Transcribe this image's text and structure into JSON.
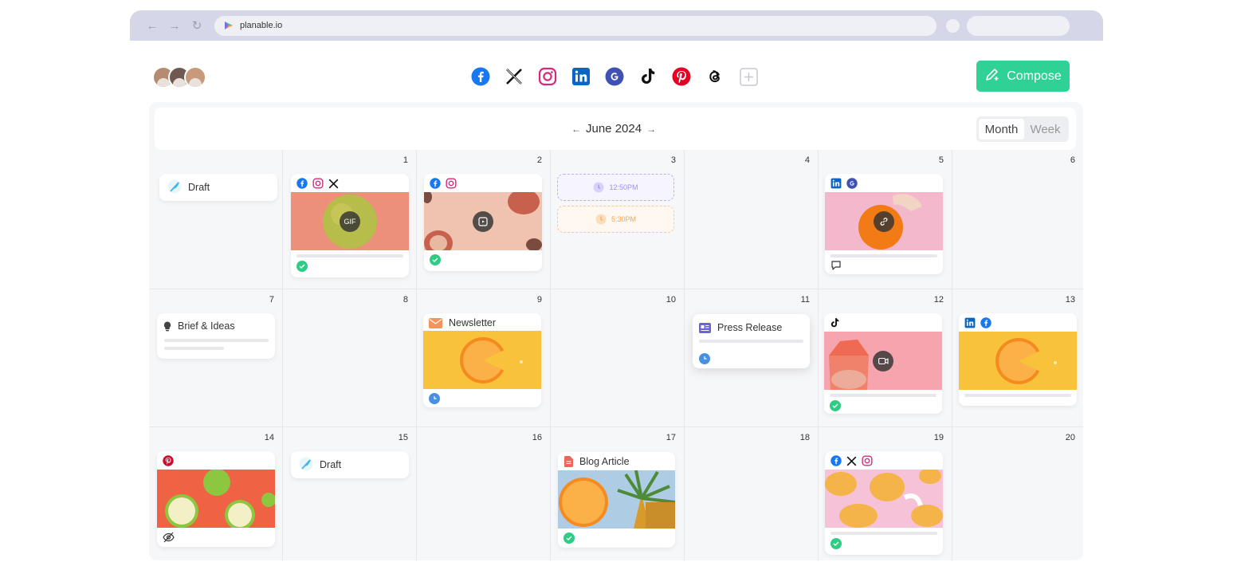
{
  "browser": {
    "url": "planable.io"
  },
  "header": {
    "compose_label": "Compose"
  },
  "calendar": {
    "month_label": "June 2024",
    "views": [
      "Month",
      "Week"
    ],
    "active_view": "Month",
    "day_numbers": [
      "1",
      "2",
      "3",
      "4",
      "5",
      "6",
      "7",
      "8",
      "9",
      "10",
      "11",
      "12",
      "13",
      "14",
      "15",
      "16",
      "17",
      "18",
      "19",
      "20"
    ]
  },
  "cards": {
    "draft1": "Draft",
    "slot_a": "12:50PM",
    "slot_b": "5:30PM",
    "brief": "Brief & Ideas",
    "newsletter": "Newsletter",
    "press": "Press Release",
    "draft2": "Draft",
    "blog": "Blog Article",
    "overlay_gif": "GIF"
  },
  "colors": {
    "accent": "#2fd194",
    "check": "#2fcc85",
    "clock": "#4a90e2"
  }
}
